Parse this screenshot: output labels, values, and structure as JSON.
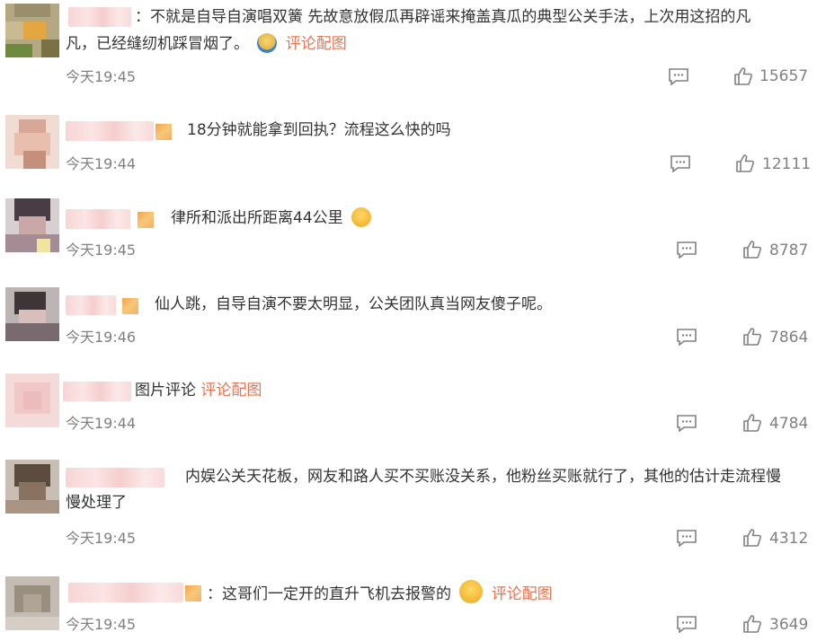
{
  "comments": [
    {
      "line1": "：不就是自导自演唱双簧 先故意放假瓜再辟谣来掩盖真瓜的典型公关手法，上次用这招的凡",
      "line2": "凡，已经缝纫机踩冒烟了。",
      "link": "评论配图",
      "emoji": "bear-emoji",
      "time": "今天19:45",
      "likes": "15657"
    },
    {
      "line1": "18分钟就能拿到回执？流程这么快的吗",
      "time": "今天19:44",
      "likes": "12111"
    },
    {
      "line1": "律所和派出所距离44公里",
      "emoji": "laugh-cry-emoji",
      "time": "今天19:45",
      "likes": "8787"
    },
    {
      "line1": "仙人跳，自导自演不要太明显，公关团队真当网友傻子呢。",
      "time": "今天19:46",
      "likes": "7864"
    },
    {
      "line1": "图片评论",
      "link": "评论配图",
      "time": "今天19:44",
      "likes": "4784"
    },
    {
      "line1": "内娱公关天花板，网友和路人买不买账没关系，他粉丝买账就行了，其他的估计走流程慢",
      "line2": "慢处理了",
      "time": "今天19:45",
      "likes": "4312"
    },
    {
      "line1": "：这哥们一定开的直升飞机去报警的",
      "link": "评论配图",
      "emoji": "shocked-emoji",
      "time": "今天19:45",
      "likes": "3649"
    }
  ],
  "colors": {
    "link": "#eb7350",
    "meta": "#808080",
    "text": "#333333"
  }
}
